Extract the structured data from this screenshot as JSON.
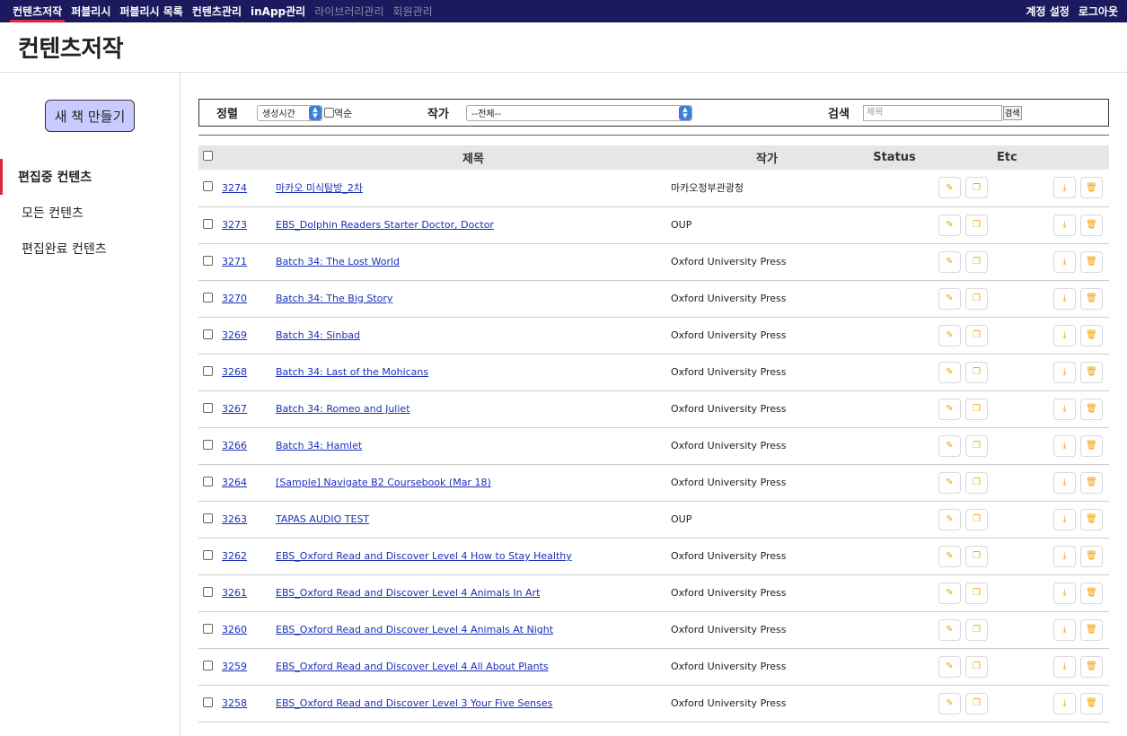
{
  "topnav": {
    "items": [
      "컨텐츠저작",
      "퍼블리시",
      "퍼블리시 목록",
      "컨텐츠관리",
      "inApp관리",
      "라이브러리관리",
      "회원관리"
    ],
    "account": "계정 설정",
    "logout": "로그아웃"
  },
  "page_title": "컨텐츠저작",
  "sidebar": {
    "new_book": "새 책 만들기",
    "items": [
      "편집중 컨텐츠",
      "모든 컨텐츠",
      "편집완료 컨텐츠"
    ]
  },
  "filter": {
    "sort_label": "정렬",
    "sort_value": "생성시간",
    "reverse_label": "역순",
    "author_label": "작가",
    "author_value": "--전체--",
    "search_label": "검색",
    "search_placeholder": "제목",
    "search_button": "검색"
  },
  "table": {
    "headers": {
      "title": "제목",
      "author": "작가",
      "status": "Status",
      "etc": "Etc"
    },
    "rows": [
      {
        "id": "3274",
        "title": "마카오 미식탐방_2차",
        "author": "마카오정부관광청",
        "status": ""
      },
      {
        "id": "3273",
        "title": "EBS_Dolphin Readers Starter Doctor, Doctor",
        "author": "OUP",
        "status": ""
      },
      {
        "id": "3271",
        "title": "Batch 34: The Lost World",
        "author": "Oxford University Press",
        "status": ""
      },
      {
        "id": "3270",
        "title": "Batch 34: The Big Story",
        "author": "Oxford University Press",
        "status": ""
      },
      {
        "id": "3269",
        "title": "Batch 34: Sinbad",
        "author": "Oxford University Press",
        "status": ""
      },
      {
        "id": "3268",
        "title": "Batch 34: Last of the Mohicans",
        "author": "Oxford University Press",
        "status": ""
      },
      {
        "id": "3267",
        "title": "Batch 34: Romeo and Juliet",
        "author": "Oxford University Press",
        "status": ""
      },
      {
        "id": "3266",
        "title": "Batch 34: Hamlet",
        "author": "Oxford University Press",
        "status": ""
      },
      {
        "id": "3264",
        "title": "[Sample] Navigate B2 Coursebook (Mar 18)",
        "author": "Oxford University Press",
        "status": ""
      },
      {
        "id": "3263",
        "title": "TAPAS AUDIO TEST",
        "author": "OUP",
        "status": ""
      },
      {
        "id": "3262",
        "title": "EBS_Oxford Read and Discover Level 4 How to Stay Healthy",
        "author": "Oxford University Press",
        "status": ""
      },
      {
        "id": "3261",
        "title": "EBS_Oxford Read and Discover Level 4 Animals In Art",
        "author": "Oxford University Press",
        "status": ""
      },
      {
        "id": "3260",
        "title": "EBS_Oxford Read and Discover Level 4 Animals At Night",
        "author": "Oxford University Press",
        "status": ""
      },
      {
        "id": "3259",
        "title": "EBS_Oxford Read and Discover Level 4 All About Plants",
        "author": "Oxford University Press",
        "status": ""
      },
      {
        "id": "3258",
        "title": "EBS_Oxford Read and Discover Level 3 Your Five Senses",
        "author": "Oxford University Press",
        "status": ""
      }
    ]
  },
  "icons": {
    "edit": "edit-icon",
    "copy": "copy-icon",
    "download": "download-icon",
    "delete": "trash-icon"
  },
  "colors": {
    "nav_bg": "#1c1a5e",
    "accent_red": "#e0263a",
    "link": "#1a2fb8",
    "icon_orange": "#f2a000",
    "new_book_bg": "#c9cbff"
  }
}
